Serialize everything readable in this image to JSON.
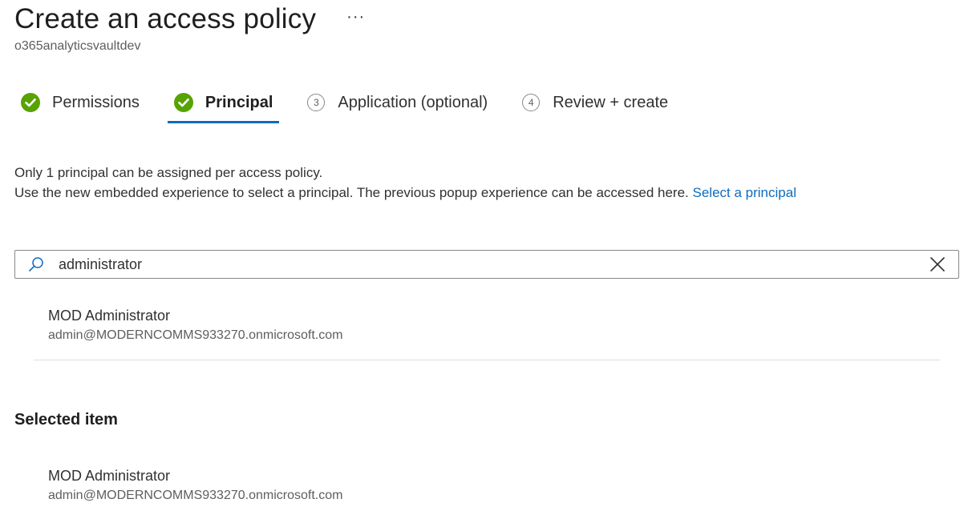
{
  "header": {
    "title": "Create an access policy",
    "more_label": "···",
    "subtitle": "o365analyticsvaultdev"
  },
  "tabs": [
    {
      "label": "Permissions",
      "state": "completed",
      "icon": "check-circle-icon"
    },
    {
      "label": "Principal",
      "state": "completed-active",
      "icon": "check-circle-icon"
    },
    {
      "label": "Application (optional)",
      "state": "pending",
      "number": "3"
    },
    {
      "label": "Review + create",
      "state": "pending",
      "number": "4"
    }
  ],
  "info": {
    "line1": "Only 1 principal can be assigned per access policy.",
    "line2": "Use the new embedded experience to select a principal. The previous popup experience can be accessed here.",
    "link": "Select a principal"
  },
  "search": {
    "value": "administrator",
    "icon": "search-icon",
    "clear_icon": "close-icon"
  },
  "results": [
    {
      "name": "MOD Administrator",
      "email": "admin@MODERNCOMMS933270.onmicrosoft.com"
    }
  ],
  "selected": {
    "heading": "Selected item",
    "name": "MOD Administrator",
    "email": "admin@MODERNCOMMS933270.onmicrosoft.com"
  },
  "colors": {
    "accent": "#0f6cbd",
    "success": "#57a300",
    "text": "#323130"
  }
}
